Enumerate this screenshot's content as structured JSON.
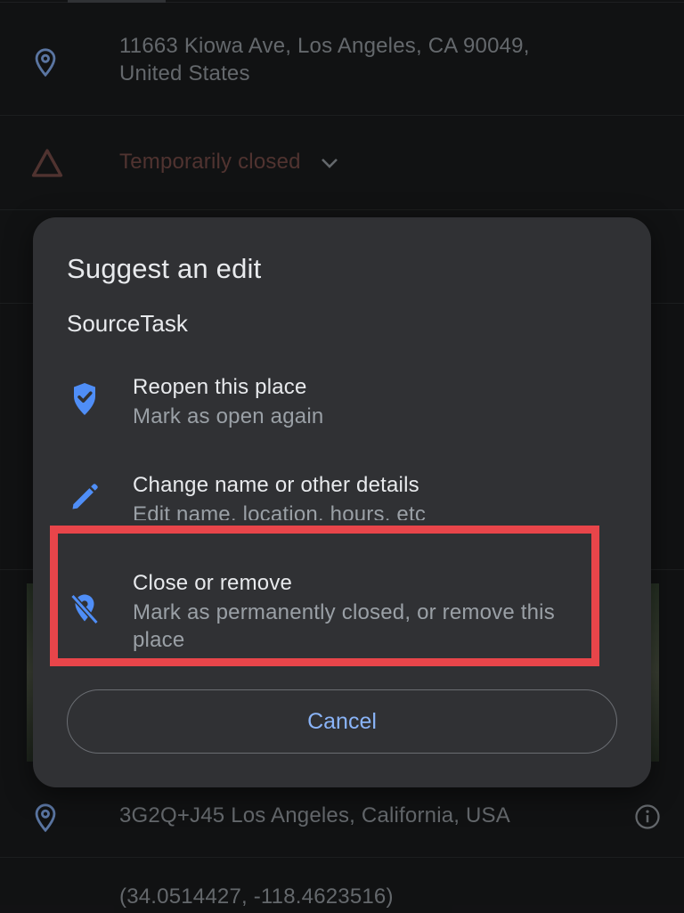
{
  "background": {
    "address": {
      "icon": "location-pin-icon",
      "line1": "11663 Kiowa Ave, Los Angeles, CA 90049,",
      "line2": "United States"
    },
    "status": {
      "icon": "warning-triangle-icon",
      "text": "Temporarily closed",
      "expand_icon": "chevron-down-icon"
    },
    "plus_code": {
      "icon": "location-pin-icon",
      "text": "3G2Q+J45 Los Angeles, California, USA",
      "info_icon": "info-icon"
    },
    "coordinates": {
      "text": "(34.0514427, -118.4623516)"
    }
  },
  "dialog": {
    "title": "Suggest an edit",
    "subtitle": "SourceTask",
    "options": [
      {
        "icon": "verified-pin-icon",
        "label": "Reopen this place",
        "description": "Mark as open again"
      },
      {
        "icon": "pencil-icon",
        "label": "Change name or other details",
        "description": "Edit name, location, hours, etc"
      },
      {
        "icon": "location-off-icon",
        "label": "Close or remove",
        "description": "Mark as permanently closed, or remove this place"
      }
    ],
    "cancel_label": "Cancel"
  },
  "colors": {
    "accent": "#8ab4f8",
    "icon_blue": "#4f8ef7",
    "warning": "#7b4f4a",
    "highlight": "#e8454a",
    "dialog_bg": "#303134",
    "page_bg": "#1b1c1e"
  }
}
